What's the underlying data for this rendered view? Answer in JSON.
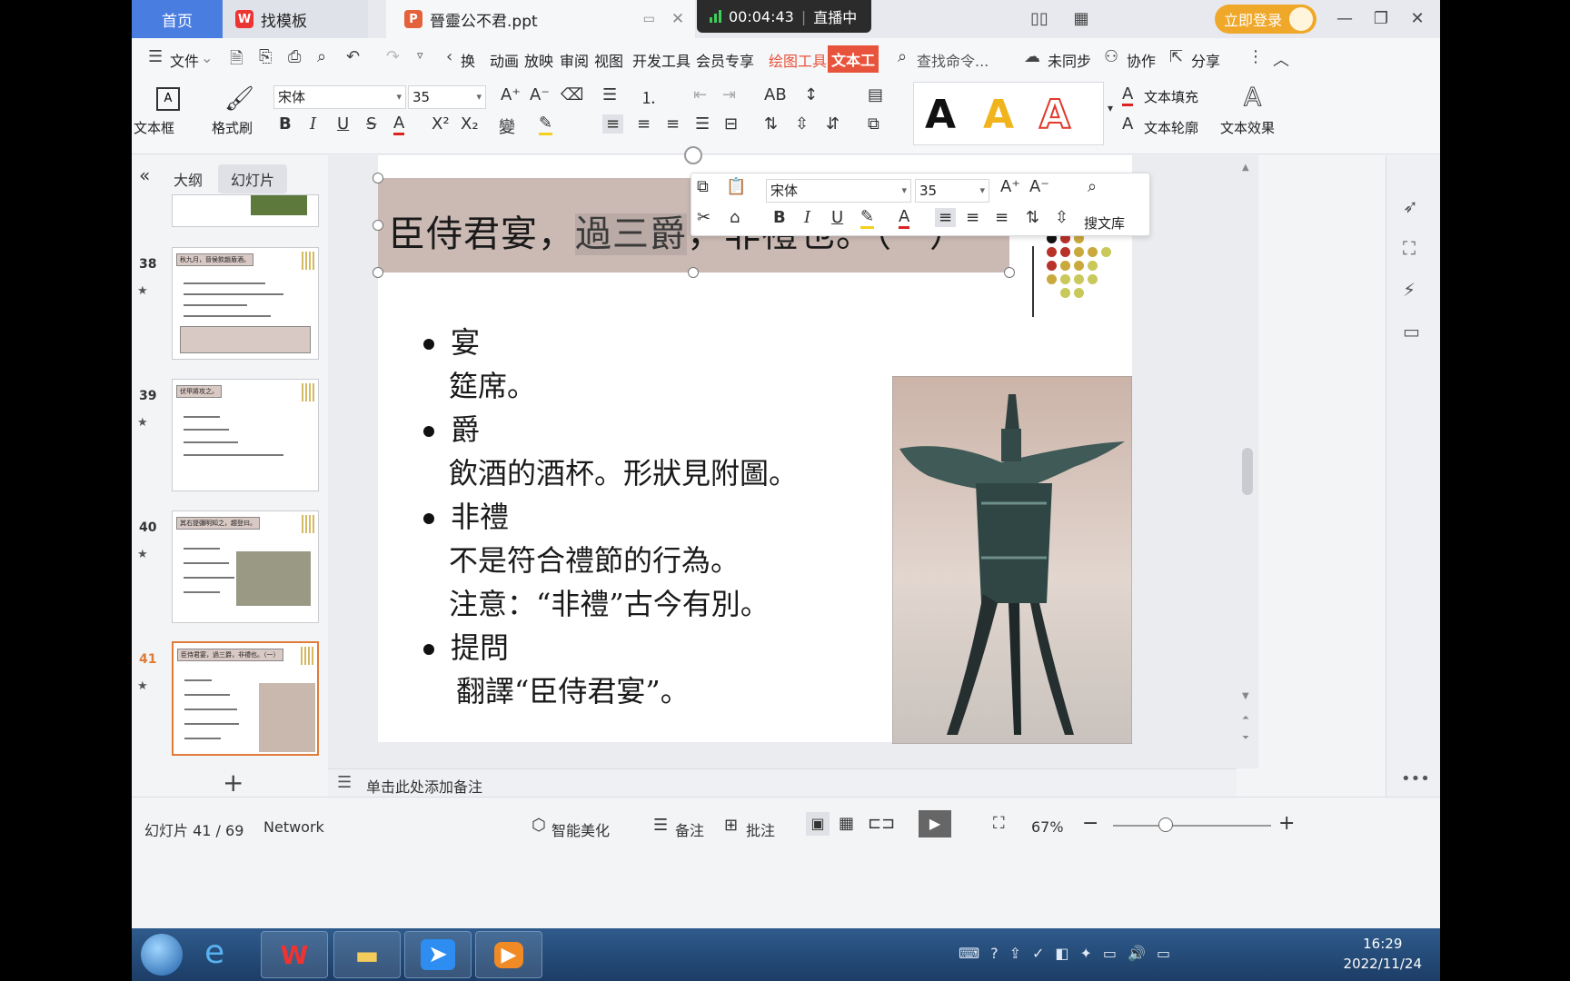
{
  "titlebar": {
    "home_tab": "首页",
    "template_tab": "找模板",
    "doc_tab": "晉靈公不君.ppt",
    "live_time": "00:04:43",
    "live_status": "直播中",
    "login": "立即登录"
  },
  "menu": {
    "file": "文件",
    "items": [
      "换",
      "动画",
      "放映",
      "审阅",
      "视图",
      "开发工具",
      "会员专享"
    ],
    "drawing_tools": "绘图工具",
    "text_tools": "文本工",
    "search": "查找命令...",
    "sync": "未同步",
    "collab": "协作",
    "share": "分享"
  },
  "ribbon": {
    "textbox": "文本框",
    "format_painter": "格式刷",
    "font": "宋体",
    "size": "35",
    "text_fill": "文本填充",
    "text_outline": "文本轮廓",
    "text_effect": "文本效果",
    "style_letter": "A"
  },
  "panel": {
    "outline_tab": "大纲",
    "slides_tab": "幻灯片",
    "thumbs": [
      {
        "num": "38",
        "title": "秋九月，晉侯飲趙盾酒。"
      },
      {
        "num": "39",
        "title": "伏甲將攻之。"
      },
      {
        "num": "40",
        "title": "其右提彌明知之，趨登曰。"
      },
      {
        "num": "41",
        "title": "臣侍君宴，過三爵，非禮也。（一）"
      }
    ],
    "add": "+"
  },
  "slide": {
    "title_pre": "臣侍君宴，",
    "title_hl": "過三爵",
    "title_post": "，非禮也。（一）",
    "bullets": [
      {
        "term": "宴",
        "defs": [
          "筵席。"
        ]
      },
      {
        "term": "爵",
        "defs": [
          "飲酒的酒杯。形狀見附圖。"
        ]
      },
      {
        "term": "非禮",
        "defs": [
          "不是符合禮節的行為。",
          "注意：“非禮”古今有別。"
        ]
      },
      {
        "term": "提問",
        "defs": [
          "翻譯“臣侍君宴”。"
        ]
      }
    ]
  },
  "mini_toolbar": {
    "font": "宋体",
    "size": "35",
    "search_lib": "搜文库"
  },
  "notes": "单击此处添加备注",
  "status": {
    "slide_info": "幻灯片 41 / 69",
    "theme": "Network",
    "beautify": "智能美化",
    "notes_btn": "备注",
    "comment_btn": "批注",
    "zoom": "67%"
  },
  "taskbar": {
    "time": "16:29",
    "date": "2022/11/24"
  },
  "colors": {
    "accent": "#4a7de0",
    "active_thumb": "#e07b39",
    "title_box": "#cbb9b4",
    "drawing_tools": "#e8533b"
  }
}
